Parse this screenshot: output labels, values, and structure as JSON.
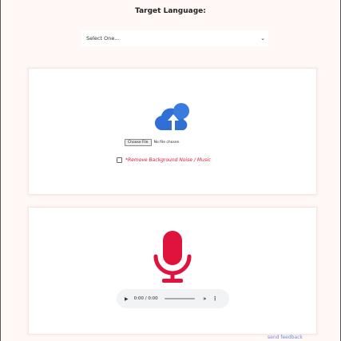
{
  "header": {
    "target_language_label": "Target Language:"
  },
  "language_select": {
    "value": "Select One..."
  },
  "upload": {
    "icon": "cloud-upload-icon",
    "choose_file_label": "Choose File",
    "file_status": "No file chosen",
    "remove_bg_label": "*Remove Background Noise / Music",
    "remove_bg_checked": false
  },
  "record": {
    "icon": "microphone-icon",
    "player_time": "0:00 / 0:00"
  },
  "footer": {
    "feedback_link": "send feedback"
  },
  "colors": {
    "accent": "#e0133c",
    "cloud": "#2f6fd6",
    "link": "#6a8fd8"
  }
}
